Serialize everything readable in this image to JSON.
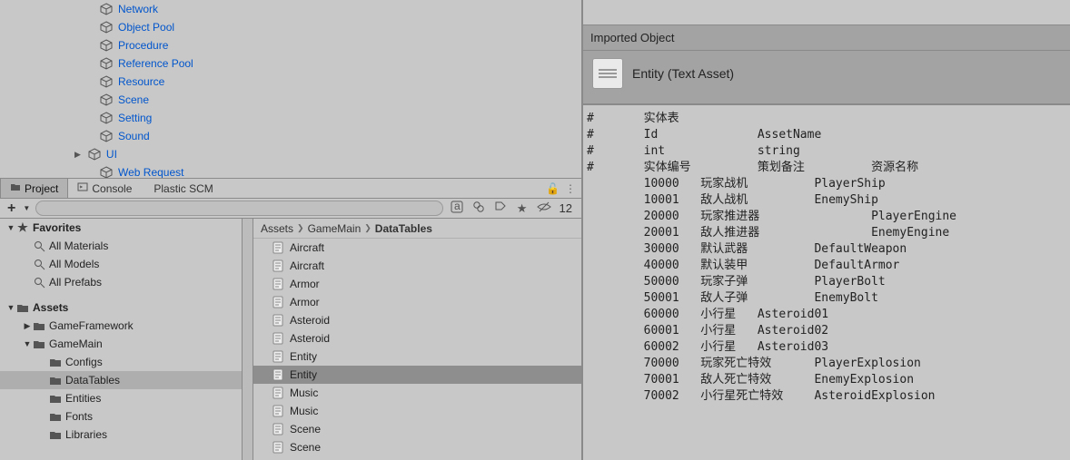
{
  "hierarchy": {
    "items": [
      {
        "label": "Network",
        "arrow": false
      },
      {
        "label": "Object Pool",
        "arrow": false
      },
      {
        "label": "Procedure",
        "arrow": false
      },
      {
        "label": "Reference Pool",
        "arrow": false
      },
      {
        "label": "Resource",
        "arrow": false
      },
      {
        "label": "Scene",
        "arrow": false
      },
      {
        "label": "Setting",
        "arrow": false
      },
      {
        "label": "Sound",
        "arrow": false
      },
      {
        "label": "UI",
        "arrow": true
      },
      {
        "label": "Web Request",
        "arrow": false
      }
    ]
  },
  "projectPanel": {
    "tabs": [
      {
        "label": "Project",
        "active": true
      },
      {
        "label": "Console",
        "active": false
      },
      {
        "label": "Plastic SCM",
        "active": false
      }
    ],
    "hiddenCount": "12",
    "search": {
      "placeholder": ""
    },
    "favorites": {
      "title": "Favorites",
      "items": [
        "All Materials",
        "All Models",
        "All Prefabs"
      ]
    },
    "assetsRoot": {
      "title": "Assets",
      "children": [
        {
          "label": "GameFramework",
          "expanded": false,
          "depth": 1,
          "hasChildren": true,
          "selected": false
        },
        {
          "label": "GameMain",
          "expanded": true,
          "depth": 1,
          "hasChildren": true,
          "selected": false
        },
        {
          "label": "Configs",
          "expanded": false,
          "depth": 2,
          "hasChildren": false,
          "selected": false
        },
        {
          "label": "DataTables",
          "expanded": false,
          "depth": 2,
          "hasChildren": false,
          "selected": true
        },
        {
          "label": "Entities",
          "expanded": false,
          "depth": 2,
          "hasChildren": false,
          "selected": false
        },
        {
          "label": "Fonts",
          "expanded": false,
          "depth": 2,
          "hasChildren": false,
          "selected": false
        },
        {
          "label": "Libraries",
          "expanded": false,
          "depth": 2,
          "hasChildren": false,
          "selected": false
        }
      ]
    },
    "breadcrumb": [
      "Assets",
      "GameMain",
      "DataTables"
    ],
    "assetList": [
      {
        "label": "Aircraft",
        "selected": false
      },
      {
        "label": "Aircraft",
        "selected": false
      },
      {
        "label": "Armor",
        "selected": false
      },
      {
        "label": "Armor",
        "selected": false
      },
      {
        "label": "Asteroid",
        "selected": false
      },
      {
        "label": "Asteroid",
        "selected": false
      },
      {
        "label": "Entity",
        "selected": false
      },
      {
        "label": "Entity",
        "selected": true
      },
      {
        "label": "Music",
        "selected": false
      },
      {
        "label": "Music",
        "selected": false
      },
      {
        "label": "Scene",
        "selected": false
      },
      {
        "label": "Scene",
        "selected": false
      }
    ]
  },
  "inspector": {
    "sectionTitle": "Imported Object",
    "assetTitle": "Entity (Text Asset)",
    "lines": [
      "#\t实体表",
      "#\tId\t\tAssetName",
      "#\tint\t\tstring",
      "#\t实体编号\t\t策划备注\t\t资源名称",
      "\t10000\t玩家战机\t\tPlayerShip",
      "\t10001\t敌人战机\t\tEnemyShip",
      "\t20000\t玩家推进器\t\tPlayerEngine",
      "\t20001\t敌人推进器\t\tEnemyEngine",
      "\t30000\t默认武器\t\tDefaultWeapon",
      "\t40000\t默认装甲\t\tDefaultArmor",
      "\t50000\t玩家子弹\t\tPlayerBolt",
      "\t50001\t敌人子弹\t\tEnemyBolt",
      "\t60000\t小行星\tAsteroid01",
      "\t60001\t小行星\tAsteroid02",
      "\t60002\t小行星\tAsteroid03",
      "\t70000\t玩家死亡特效\tPlayerExplosion",
      "\t70001\t敌人死亡特效\tEnemyExplosion",
      "\t70002\t小行星死亡特效\tAsteroidExplosion"
    ]
  }
}
